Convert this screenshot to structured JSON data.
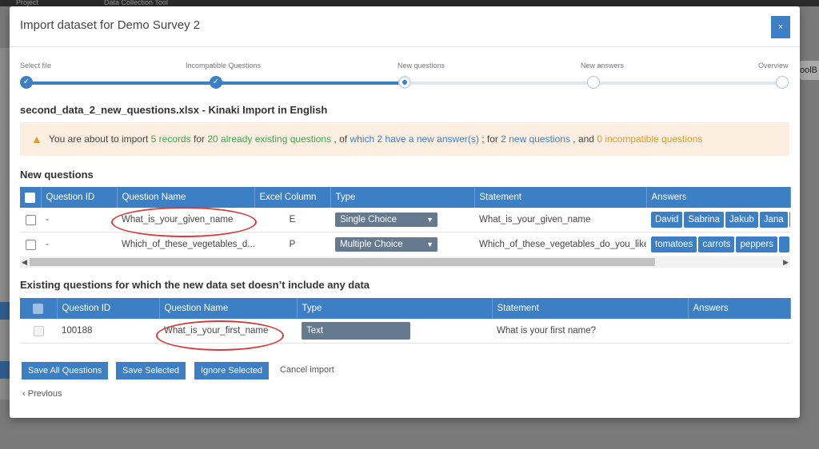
{
  "background": {
    "top_items": [
      "Project",
      "Data Collection Tool"
    ],
    "right_tab": "oolB"
  },
  "modal": {
    "title": "Import dataset for Demo Survey 2",
    "close_label": "×"
  },
  "stepper": {
    "steps": [
      "Select file",
      "Incompatible Questions",
      "New questions",
      "New answers",
      "Overview"
    ],
    "current_step": 3,
    "progress_fraction": 0.5
  },
  "file_title": "second_data_2_new_questions.xlsx - Kinaki Import in English",
  "alert": {
    "t1": "You are about to import ",
    "records": "5 records",
    "t2": " for ",
    "existing": "20 already existing questions",
    "t3": " , of ",
    "new_answer": "which 2 have a new answer(s)",
    "t4": " ; for ",
    "new_q": "2 new questions",
    "t5": " , and ",
    "incompatible": "0 incompatible questions"
  },
  "new_questions": {
    "title": "New questions",
    "headers": [
      "Question ID",
      "Question Name",
      "Excel Column",
      "Type",
      "Statement",
      "Answers"
    ],
    "rows": [
      {
        "id": "-",
        "name": "What_is_your_given_name",
        "column": "E",
        "type": "Single Choice",
        "statement": "What_is_your_given_name",
        "answers": [
          "David",
          "Sabrina",
          "Jakub",
          "Jana"
        ]
      },
      {
        "id": "-",
        "name": "Which_of_these_vegetables_d...",
        "column": "P",
        "type": "Multiple Choice",
        "statement": "Which_of_these_vegetables_do_you_like",
        "answers": [
          "tomatoes",
          "carrots",
          "peppers"
        ]
      }
    ]
  },
  "existing_questions": {
    "title": "Existing questions for which the new data set doesn’t include any data",
    "headers": [
      "Question ID",
      "Question Name",
      "Type",
      "Statement",
      "Answers"
    ],
    "rows": [
      {
        "id": "100188",
        "name": "What_is_your_first_name",
        "type": "Text",
        "statement": "What is your first name?"
      }
    ]
  },
  "actions": {
    "save_all": "Save All Questions",
    "save_selected": "Save Selected",
    "ignore_selected": "Ignore Selected",
    "cancel": "Cancel import",
    "previous": "Previous"
  },
  "colors": {
    "primary": "#3d7fc4",
    "success": "#3aa84a",
    "warning": "#e39a2d",
    "alert_bg": "#fcefe2",
    "annotation": "#d63b3b"
  }
}
